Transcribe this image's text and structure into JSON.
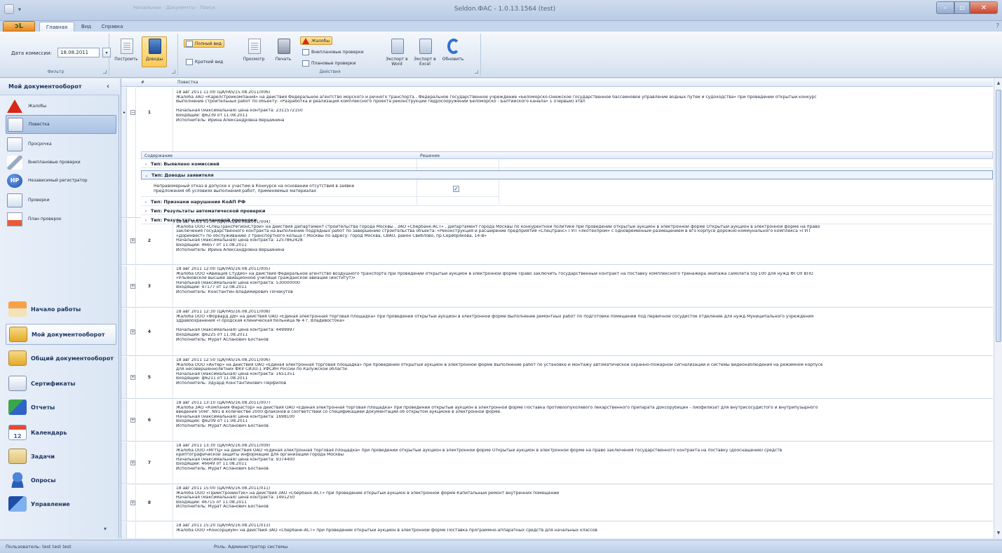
{
  "window": {
    "title": "Seldon.ФАС - 1.0.13.1564 (test)",
    "faint_menu": "Начальная · Документы · Поиск"
  },
  "tabs": [
    "Главная",
    "Вид",
    "Справка"
  ],
  "help": "?",
  "ribbon": {
    "filter": {
      "date_label": "Дата комиссии:",
      "date_value": "18.08.2011",
      "group_label": "Фильтр"
    },
    "buttons": {
      "build": "Построить",
      "arguments": "Доводы",
      "full_view": "Полный вид",
      "short_view": "Краткий вид",
      "preview": "Просмотр",
      "print": "Печать",
      "complaints": "Жалобы",
      "unplanned": "Внеплановые проверки",
      "planned": "Плановые проверки",
      "export_word": "Экспорт в Word",
      "export_excel": "Экспорт в Excel",
      "refresh": "Обновить"
    },
    "actions_label": "Действия"
  },
  "sidebar": {
    "title": "Мой документооборот",
    "items": [
      {
        "label": "Жалобы"
      },
      {
        "label": "Повестка"
      },
      {
        "label": "Просрочка"
      },
      {
        "label": "Внеплановые проверки"
      },
      {
        "label": "Независимый регистратор"
      },
      {
        "label": "Проверки"
      },
      {
        "label": "План проверок"
      }
    ],
    "hp_badge": "HP",
    "nav": [
      {
        "label": "Начало работы"
      },
      {
        "label": "Мой документооборот"
      },
      {
        "label": "Общий документооборот"
      },
      {
        "label": "Сертификаты"
      },
      {
        "label": "Отчеты"
      },
      {
        "label": "Календарь"
      },
      {
        "label": "Задачи"
      },
      {
        "label": "Опросы"
      },
      {
        "label": "Управление"
      }
    ],
    "calendar_day": "12"
  },
  "grid": {
    "headers": {
      "num": "#",
      "agenda": "Повестка"
    },
    "rows": [
      {
        "num": "1",
        "lines": [
          "18 авг 2011 11:00 (ЦА/FAS/15.08.2011/006)",
          "Жалоба ЗАО «Карелстройкомпания» на действия Федеральное агентство морского и речного транспорта , Федеральное государственное учреждение «Беломорско-Онежское государственное бассейновое управление водных путей и судоходства» при проведении открытый конкурс",
          "Выполнение строительных работ по объекту: «Разработка и реализация комплексного проекта реконструкции гидросооружений Беломорско - Балтийского канала» 1 (Первый) этап",
          "",
          "Начальная (максимальная) цена контракта: 2311572150",
          "Входящий: ф6239 от 11.08.2011",
          "Исполнитель: Ирина Александровна Вершинина"
        ]
      },
      {
        "num": "2",
        "lines": [
          "18 авг 2011 11:30 (ЦА/FAS/16.08.2011/004)",
          "Жалоба ООО «СпецТрансРегионСтрой» на действия Департамент строительства города Москвы , ЗАО «Сбербанк-АСТ» , Департамент города Москвы по конкурентной политике при проведении  открытый аукцион в электронной форме Открытый аукцион в электронной форме на право",
          "заключения государственного контракта на выполнение подрядных работ по завершению строительства объекта: «Реконструкция и расширение предприятия «Спецтранс» ГУП «Экотехпром» с одновременным размещением в его корпусе дорожно-коммунального комплекса «ГУП",
          "«Доринвест» по обслуживанию 3 транспортного кольца г.Москвы по адресу: город Москва, СВАО, район Свиблово, пр.Серебрякова, 14-В»",
          "Начальная (максимальная) цена контракта: 1257862428",
          "Входящий: 46657 от 11.08.2011",
          "Исполнитель: Ирина Александровна Вершинина"
        ]
      },
      {
        "num": "3",
        "lines": [
          "18 авг 2011 12:00 (ЦА/FAS/16.08.2011/005)",
          "Жалоба ООО «Авиация Студио» на действия Федеральное агентство воздушного транспорта при проведении  открытый аукцион в электронной форме Право заключить государственный контракт на поставку комплексного тренажера экипажа самолета SSJ-100 для нужд ФГОУ ВПО",
          "«Ульяновское высшее авиационное училище гражданской авиации (институт)»",
          "Начальная (максимальная) цена контракта: 530000000",
          "Входящий: 47177 от 12.08.2011",
          "Исполнитель: Константин Владимирович Почекутов"
        ]
      },
      {
        "num": "4",
        "lines": [
          "18 авг 2011 12:30 (ЦА/FAS/16.08.2011/008)",
          "Жалоба ООО «Форвард ДВ» на действия ОАО «Единая электронная торговая площадка» при проведении  открытый аукцион в электронной форме Выполнение ремонтных работ по подготовке помещений под первичное сосудистое отделение для нужд Муниципального учреждения",
          "здравоохранения «Городская клиническая больница № 4 г. Владивостока»",
          "",
          "Начальная (максимальная) цена контракта: 4499997",
          "Входящий: ф6225 от 11.08.2011",
          "Исполнитель: Мурат Асланович Бостанов"
        ]
      },
      {
        "num": "5",
        "lines": [
          "18 авг 2011 12:50 (ЦА/FAS/16.08.2011/006)",
          "Жалоба ООО «Антер» на действия ОАО «Единая электронная торговая площадка» при проведении  открытый аукцион в электронной форме Выполнение работ по установке и монтажу автоматической охранно-пожарной сигнализации и системы видеонаблюдения на режимном корпусе",
          "для несовершеннолетних ФКУ СИЗО-1 УФСИН России по Калужской области",
          "Начальная (максимальная) цена контракта: 1651351",
          "Входящий: ф6211 от 11.08.2011",
          "Исполнитель: Эдуард Константинович Перфилов"
        ]
      },
      {
        "num": "6",
        "lines": [
          "18 авг 2011 13:10 (ЦА/FAS/16.08.2011/007)",
          "Жалоба ЗАО «Компания Фарастор» на действия ОАО «Единая электронная торговая площадка» при проведении  открытый аукцион в электронной форме Поставка противоопухолевого лекарственного препарата Доксорубицин - лиофилизат для внутрисосудистого и внутрипузырного",
          "введения 50мг. N91 в количестве 2000 флаконов в соответствии со спецификацией документации об открытом аукционе в электронной форме.",
          "Начальная (максимальная) цена контракта: 1698100",
          "Входящий: ф6209 от 11.08.2011",
          "Исполнитель: Мурат Асланович Бостанов"
        ]
      },
      {
        "num": "7",
        "lines": [
          "18 авг 2011 13:30 (ЦА/FAS/16.08.2011/009)",
          "Жалоба ООО «МгтЦ» на действия ОАО «Единая электронная торговая площадка» при проведении  открытый аукцион в электронной форме Открытый аукцион в электронной форме на право заключения государственного контракта на поставку (дооснащение) средств",
          "криптографической защиты информации для организаций города Москвы",
          "Начальная (максимальная) цена контракта: 9374400",
          "Входящий: 46649 от 11.08.2011",
          "Исполнитель: Мурат Асланович Бостанов"
        ]
      },
      {
        "num": "8",
        "lines": [
          "18 авг 2011 15:00 (ЦА/FAS/16.08.2011/011)",
          "Жалоба ООО «Приистройинтэк» на действия ЗАО «Сбербанк-АСТ» при проведении  открытый аукцион в электронной форме Капитальный ремонт внутренних помещений",
          "Начальная (максимальная) цена контракта: 1491250",
          "Входящий: 46715 от 11.08.2011",
          "Исполнитель: Мурат Асланович Бостанов"
        ]
      },
      {
        "num": "",
        "lines": [
          "18 авг 2011 15:20 (ЦА/FAS/16.08.2011/013)",
          "Жалоба ООО «Консорциум» на действия ЗАО «Сбербанк-АСТ» при проведении  открытый аукцион в электронной форме Поставка программно-аппаратных средств для начальных классов"
        ]
      }
    ],
    "detail": {
      "headers": {
        "content": "Содержание",
        "decision": "Решение"
      },
      "groups": [
        "Тип: Выявлено комиссией",
        "Тип: Доводы заявителя",
        "Тип: Признаки нарушения КоАП РФ",
        "Тип: Результаты автоматической проверки",
        "Тип: Результаты внеплановой проверки"
      ],
      "item_text_1": "Неправомерный отказ в допуске к участию в Конкурсе на основании отсутствия в заявке",
      "item_text_2": "предложения об условиях выполнения работ, применяемых материалах",
      "check": "✓"
    }
  },
  "status": {
    "user": "Пользователь: test test test",
    "role": "Роль: Администратор системы"
  }
}
